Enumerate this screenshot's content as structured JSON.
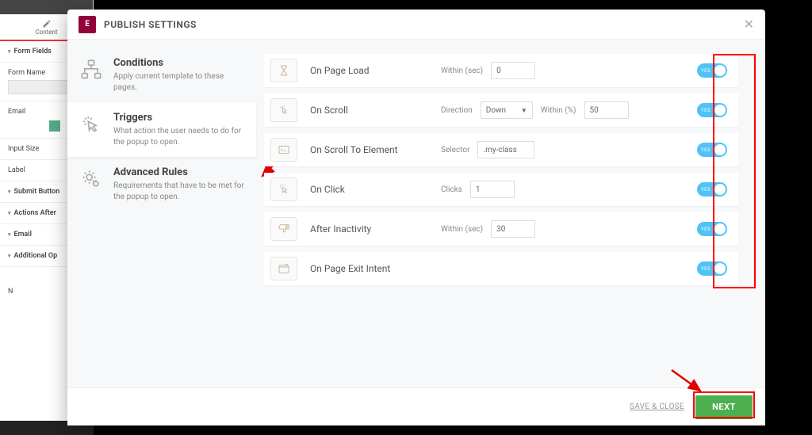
{
  "bg": {
    "tab": "Content",
    "formFields": "Form Fields",
    "formName": "Form Name",
    "email": "Email",
    "inputSize": "Input Size",
    "label": "Label",
    "submit": "Submit Button",
    "actionsAfter": "Actions After",
    "emailSection": "Email",
    "additional": "Additional Op",
    "n": "N"
  },
  "modal": {
    "title": "PUBLISH SETTINGS",
    "brand": "E"
  },
  "sidebar": [
    {
      "title": "Conditions",
      "desc": "Apply current template to these pages."
    },
    {
      "title": "Triggers",
      "desc": "What action the user needs to do for the popup to open."
    },
    {
      "title": "Advanced Rules",
      "desc": "Requirements that have to be met for the popup to open."
    }
  ],
  "triggers": [
    {
      "name": "On Page Load",
      "field1_label": "Within (sec)",
      "field1_value": "0",
      "toggle_label": "YES"
    },
    {
      "name": "On Scroll",
      "field1_label": "Direction",
      "field1_value": "Down",
      "field2_label": "Within (%)",
      "field2_value": "50",
      "toggle_label": "YES"
    },
    {
      "name": "On Scroll To Element",
      "field1_label": "Selector",
      "field1_value": ".my-class",
      "toggle_label": "YES"
    },
    {
      "name": "On Click",
      "field1_label": "Clicks",
      "field1_value": "1",
      "toggle_label": "YES"
    },
    {
      "name": "After Inactivity",
      "field1_label": "Within (sec)",
      "field1_value": "30",
      "toggle_label": "YES"
    },
    {
      "name": "On Page Exit Intent",
      "toggle_label": "YES"
    }
  ],
  "footer": {
    "save_close": "SAVE & CLOSE",
    "next": "NEXT"
  }
}
